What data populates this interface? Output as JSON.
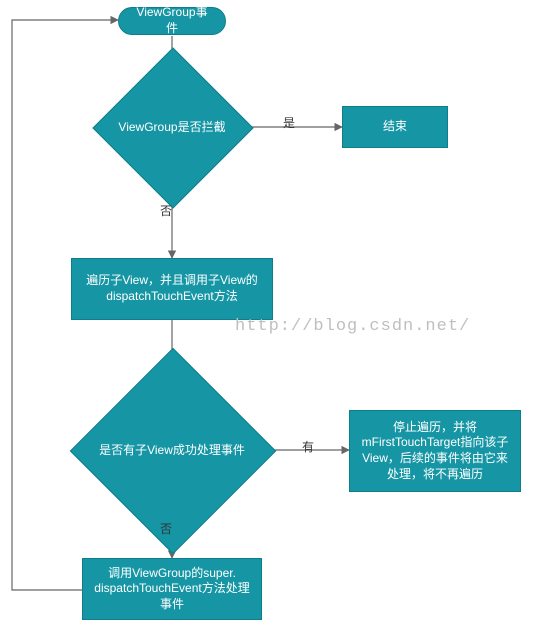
{
  "chart_data": {
    "type": "flowchart",
    "title": "",
    "nodes": [
      {
        "id": "start",
        "type": "terminator",
        "label": "ViewGroup事件"
      },
      {
        "id": "d1",
        "type": "decision",
        "label": "ViewGroup是否拦截"
      },
      {
        "id": "end1",
        "type": "process",
        "label": "结束"
      },
      {
        "id": "p1",
        "type": "process",
        "label": "遍历子View，并且调用子View的dispatchTouchEvent方法"
      },
      {
        "id": "d2",
        "type": "decision",
        "label": "是否有子View成功处理事件"
      },
      {
        "id": "p2",
        "type": "process",
        "label": "停止遍历，并将mFirstTouchTarget指向该子View，后续的事件将由它来处理，将不再遍历"
      },
      {
        "id": "p3",
        "type": "process",
        "label": "调用ViewGroup的super. dispatchTouchEvent方法处理事件"
      }
    ],
    "edges": [
      {
        "from": "start",
        "to": "d1",
        "label": ""
      },
      {
        "from": "d1",
        "to": "end1",
        "label": "是"
      },
      {
        "from": "d1",
        "to": "p1",
        "label": "否"
      },
      {
        "from": "p1",
        "to": "d2",
        "label": ""
      },
      {
        "from": "d2",
        "to": "p2",
        "label": "有"
      },
      {
        "from": "d2",
        "to": "p3",
        "label": "否"
      },
      {
        "from": "p3",
        "to": "start",
        "label": "",
        "back": true
      }
    ]
  },
  "edge_labels": {
    "d1_yes": "是",
    "d1_no": "否",
    "d2_yes": "有",
    "d2_no": "否"
  },
  "watermark": "http://blog.csdn.net/"
}
